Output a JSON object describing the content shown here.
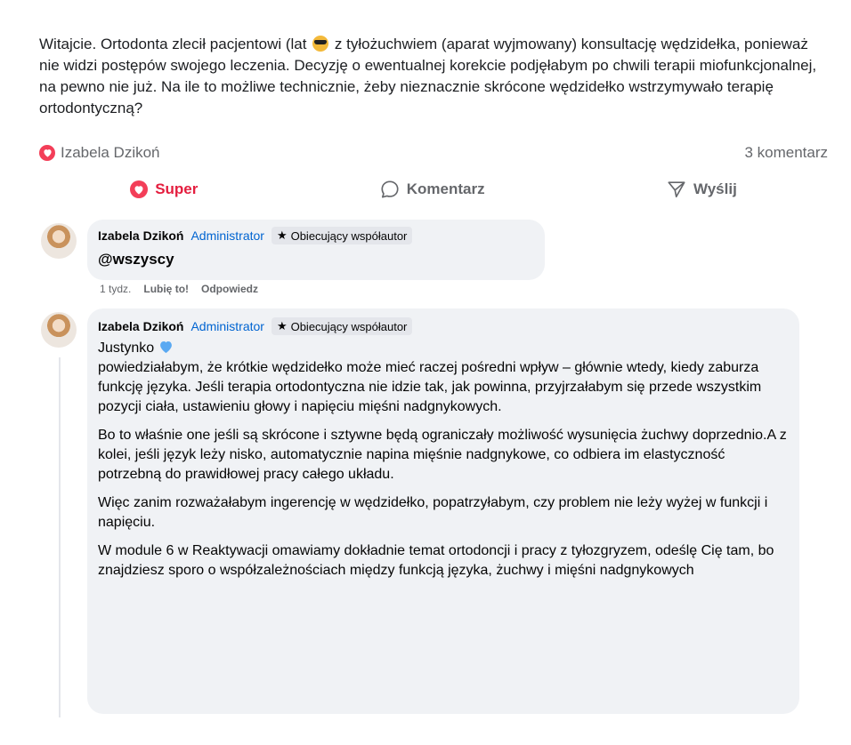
{
  "post": {
    "text_before_emoji": "Witajcie. Ortodonta zlecił pacjentowi (lat",
    "emoji_icon": "sunglasses-emoji-icon",
    "text_after_emoji": " z tyłożuchwiem (aparat wyjmowany) konsultację wędzidełka, ponieważ nie widzi postępów swojego leczenia. Decyzję o ewentualnej korekcie podjęłabym po chwili terapii miofunkcjonalnej, na pewno nie już. Na ile to możliwe technicznie, żeby nieznacznie skrócone wędzidełko wstrzymywało terapię ortodontyczną?"
  },
  "stats": {
    "reactor": "Izabela Dzikoń",
    "comments_count": "3 komentarz",
    "reaction_color": "#f33e58"
  },
  "actions": {
    "super": "Super",
    "comment": "Komentarz",
    "send": "Wyślij"
  },
  "comments": [
    {
      "author": "Izabela Dzikoń",
      "role": "Administrator",
      "badge": "Obiecujący współautor",
      "text": "@wszyscy",
      "time": "1 tydz.",
      "like": "Lubię to!",
      "reply": "Odpowiedz"
    },
    {
      "author": "Izabela Dzikoń",
      "role": "Administrator",
      "badge": "Obiecujący współautor",
      "greeting": "Justynko",
      "greeting_icon": "blue-heart-emoji-icon",
      "paragraphs": [
        "powiedziałabym, że krótkie wędzidełko może mieć raczej pośredni wpływ – głównie wtedy, kiedy zaburza funkcję języka. Jeśli terapia ortodontyczna nie idzie tak, jak powinna, przyjrzałabym się przede wszystkim pozycji ciała, ustawieniu głowy i napięciu mięśni nadgnykowych.",
        "Bo to właśnie one jeśli są skrócone i sztywne będą ograniczały możliwość wysunięcia żuchwy doprzednio.A z kolei, jeśli język leży nisko, automatycznie napina mięśnie nadgnykowe, co odbiera im elastyczność potrzebną do prawidłowej pracy całego układu.",
        "Więc zanim rozważałabym ingerencję w wędzidełko, popatrzyłabym, czy problem nie leży wyżej w funkcji i napięciu.",
        "W module 6 w Reaktywacji omawiamy dokładnie temat ortodoncji i pracy z tyłozgryzem, odeślę Cię tam, bo znajdziesz sporo o współzależnościach między funkcją języka, żuchwy i mięśni nadgnykowych"
      ]
    }
  ],
  "colors": {
    "accent_red": "#e41e3f",
    "admin_blue": "#0064d1",
    "bubble_bg": "#f0f2f5"
  }
}
